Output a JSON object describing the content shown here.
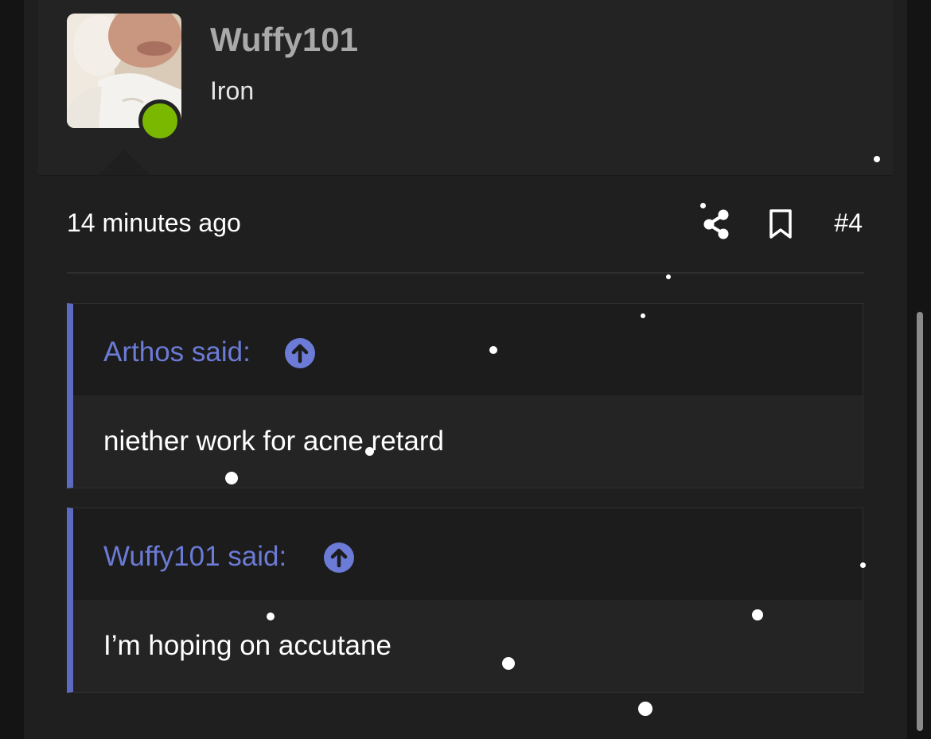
{
  "user": {
    "name": "Wuffy101",
    "title": "Iron",
    "online_color": "#7ab800"
  },
  "post": {
    "time": "14 minutes ago",
    "number": "#4",
    "actions": [
      "share-icon",
      "bookmark-icon"
    ]
  },
  "quotes": [
    {
      "author_label": "Arthos said:",
      "text": "niether work for acne retard",
      "icon": "arrow-up-circle-icon"
    },
    {
      "author_label": "Wuffy101 said:",
      "text": "I’m hoping on accutane",
      "icon": "arrow-up-circle-icon"
    }
  ],
  "colors": {
    "background": "#1f1f1f",
    "accent": "#6b7bd6",
    "quote_bar": "#5c6bc0"
  }
}
